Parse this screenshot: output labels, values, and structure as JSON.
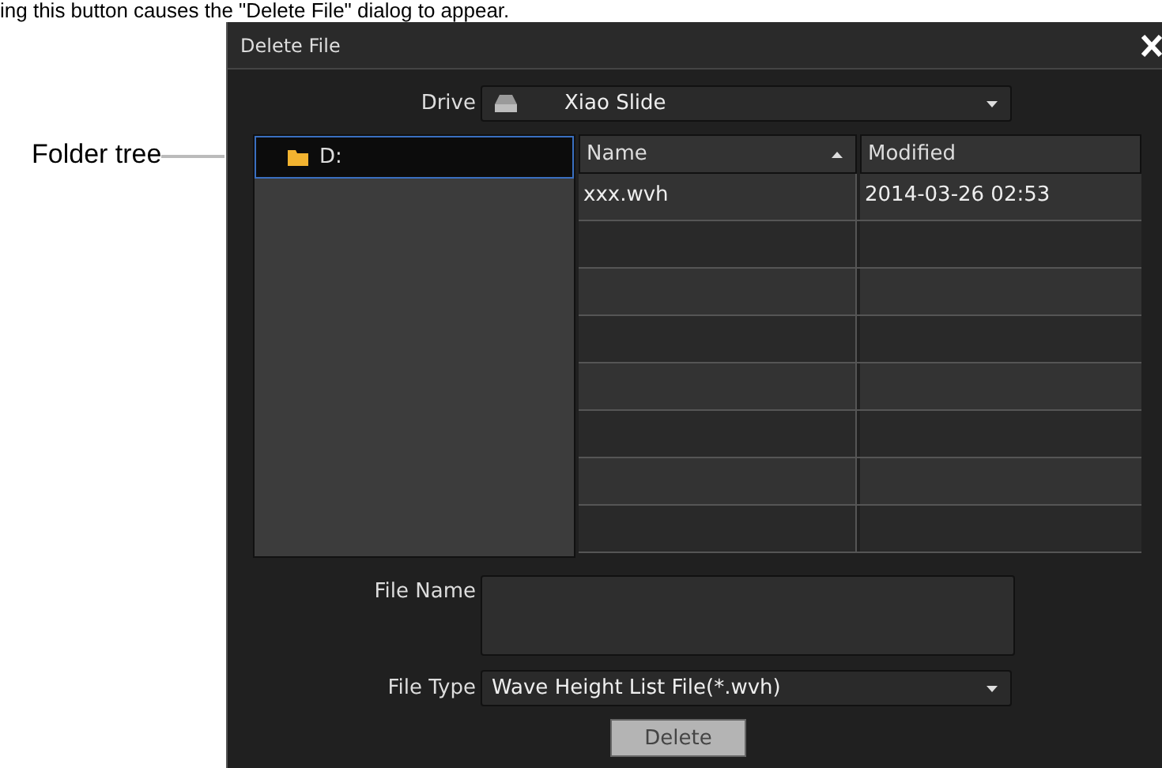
{
  "caption": "ing this button causes the \"Delete File\" dialog to appear.",
  "callout": {
    "label": "Folder tree"
  },
  "dialog": {
    "title": "Delete File",
    "drive": {
      "label": "Drive",
      "value": "Xiao Slide"
    },
    "tree": [
      {
        "label": "D:",
        "selected": true
      }
    ],
    "table": {
      "columns": [
        {
          "label": "Name",
          "sorted": true
        },
        {
          "label": "Modified",
          "sorted": false
        }
      ],
      "rows": [
        {
          "name": "xxx.wvh",
          "modified": "2014-03-26 02:53"
        },
        {},
        {},
        {},
        {},
        {},
        {},
        {}
      ]
    },
    "file_name": {
      "label": "File Name"
    },
    "file_type": {
      "label": "File Type",
      "value": "Wave Height List File(*.wvh)"
    },
    "buttons": [
      "Delete"
    ]
  }
}
